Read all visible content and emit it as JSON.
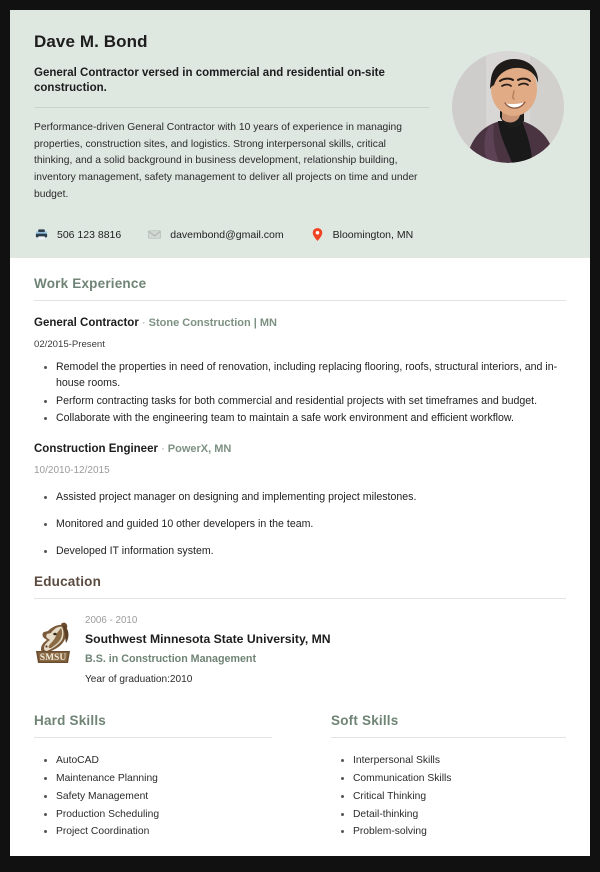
{
  "header": {
    "name": "Dave M. Bond",
    "tagline": "General Contractor versed in commercial and residential on-site construction.",
    "summary": "Performance-driven General Contractor with 10 years of experience in managing properties, construction sites, and logistics. Strong interpersonal skills, critical thinking, and a solid background in business development, relationship building, inventory management, safety management to deliver all projects on time and under budget.",
    "photo_alt": "portrait-photo",
    "background_color": "#dfe7e1"
  },
  "contact": [
    {
      "icon": "phone-icon",
      "value": "506 123 8816"
    },
    {
      "icon": "email-icon",
      "value": "davembond@gmail.com"
    },
    {
      "icon": "location-pin-icon",
      "value": "Bloomington, MN"
    }
  ],
  "work_experience": {
    "title": "Work Experience",
    "jobs": [
      {
        "title": "General Contractor",
        "separator": "·",
        "company": "Stone Construction | MN",
        "dates": "02/2015-Present",
        "bullets": [
          "Remodel the properties in need of renovation, including replacing flooring, roofs, structural interiors, and in-house rooms.",
          "Perform contracting tasks for both commercial and residential projects with set timeframes and budget.",
          "Collaborate with the engineering team to maintain a safe work environment and efficient workflow."
        ]
      },
      {
        "title": "Construction Engineer",
        "separator": "·",
        "company": "PowerX, MN",
        "dates": "10/2010-12/2015",
        "bullets": [
          "Assisted project manager on designing and implementing project milestones.",
          "Monitored and guided 10 other developers in the team.",
          "Developed IT information system."
        ]
      }
    ]
  },
  "education": {
    "title": "Education",
    "logo_name": "smsu-mustang-logo",
    "years": "2006 - 2010",
    "school": "Southwest Minnesota State University, MN",
    "degree": "B.S. in Construction Management",
    "graduation": "Year of graduation:2010"
  },
  "hard_skills": {
    "title": "Hard Skills",
    "items": [
      "AutoCAD",
      "Maintenance Planning",
      "Safety Management",
      "Production Scheduling",
      "Project Coordination"
    ]
  },
  "soft_skills": {
    "title": "Soft Skills",
    "items": [
      "Interpersonal Skills",
      "Communication Skills",
      "Critical Thinking",
      "Detail-thinking",
      "Problem-solving"
    ]
  },
  "colors": {
    "header_bg": "#dfe7e1",
    "sage_heading": "#6f8475",
    "brown_heading": "#5b4a40",
    "company_green": "#7d9182",
    "pin_red": "#f04323"
  }
}
